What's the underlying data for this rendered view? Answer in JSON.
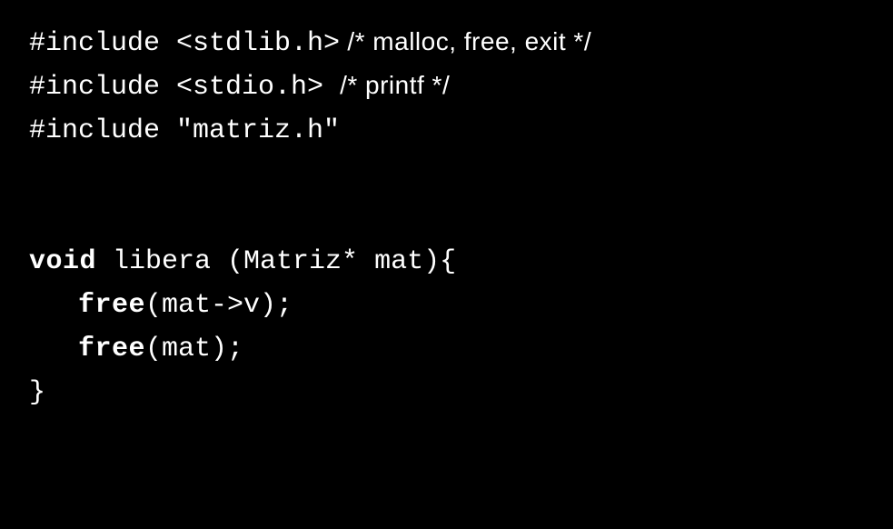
{
  "code": {
    "include1_a": "#include <stdlib.h>",
    "include1_b": " /* malloc, free, exit */",
    "include2_a": "#include <stdio.h> ",
    "include2_b": "/* printf */",
    "include3": "#include \"matriz.h\"",
    "fn_void": "void",
    "fn_sig": " libera (Matriz* mat){",
    "indent": "   ",
    "free1a": "free",
    "free1b": "(mat->v);",
    "free2a": "free",
    "free2b": "(mat);",
    "close": "}"
  }
}
